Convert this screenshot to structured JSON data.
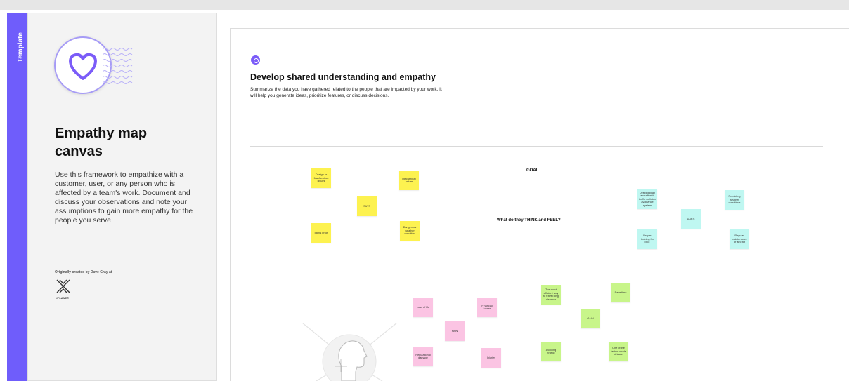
{
  "sidebar": {
    "strip_label": "Template",
    "title": "Empathy map canvas",
    "description": "Use this framework to empathize with a customer, user, or any person who is affected by a team's work. Document and discuss your observations and note your assumptions to gain more empathy for the people you serve.",
    "credit": "Originally created by Dave Gray at",
    "credit_logo_text": "XPLANE®",
    "icons": {
      "logo": "heart-icon",
      "credit": "xplane-logo-icon"
    },
    "accent_color": "#6f5dfb"
  },
  "board": {
    "title": "Develop shared understanding and empathy",
    "description": "Summarize the data you have gathered related to the people that are impacted by your work. It will help you generate ideas, prioritize features, or discuss decisions.",
    "labels": {
      "goal": "GOAL",
      "think_feel": "What do they THINK and FEEL?"
    },
    "says_notes": {
      "design": "Design or Manfunction issues",
      "mechanical": "Mechanical failure",
      "says": "SAYS",
      "pilot": "pilot's error",
      "weather": "Dangerous weather condition"
    },
    "does_notes": {
      "designing": "Designing an aircraft with traffic collision avoidance system",
      "predicting": "Predicting weather conditions",
      "does": "DOES",
      "training": "Proper training for pilot",
      "maintenance": "Regular maintenance of aircraft"
    },
    "pain_notes": {
      "loss": "Loss of life",
      "financial": "Financial losses",
      "pain": "PAIN",
      "reputation": "Reputational damage",
      "injuries": "Injuries"
    },
    "gain_notes": {
      "efficient": "The most efficient way to travel long distance",
      "save_time": "Save time",
      "gain": "GAIN",
      "avoiding": "Avoiding traffic",
      "fastest": "One of the fastest mode of travel"
    },
    "colors": {
      "says": "#fdf250",
      "does": "#bff7f1",
      "pain": "#fbc4e3",
      "gain": "#c8f58a"
    }
  }
}
